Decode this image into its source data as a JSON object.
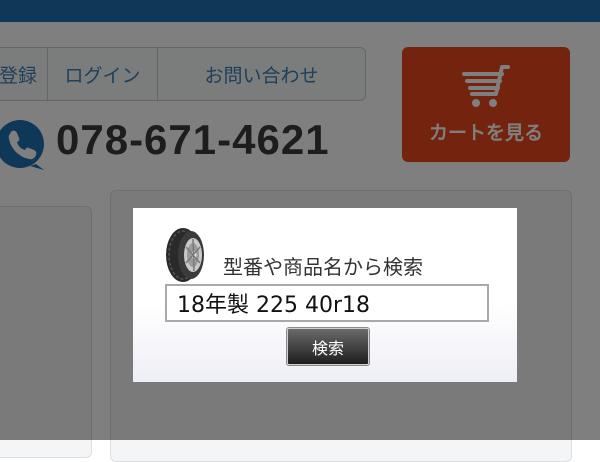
{
  "header": {
    "nav": {
      "register_label": "登録",
      "login_label": "ログイン",
      "contact_label": "お問い合わせ"
    },
    "phone_icon": "phone-icon",
    "phone_number": "078-671-4621",
    "cart": {
      "icon": "shopping-cart-icon",
      "label": "カートを見る"
    }
  },
  "colors": {
    "topbar": "#1d6fb0",
    "cart_button": "#e8461c",
    "nav_text": "#3e7fb6",
    "phone_icon": "#1d6fb0"
  },
  "search_dialog": {
    "icon": "tire-icon",
    "title": "型番や商品名から検索",
    "input_value": "18年製 225 40r18",
    "button_label": "検索"
  }
}
